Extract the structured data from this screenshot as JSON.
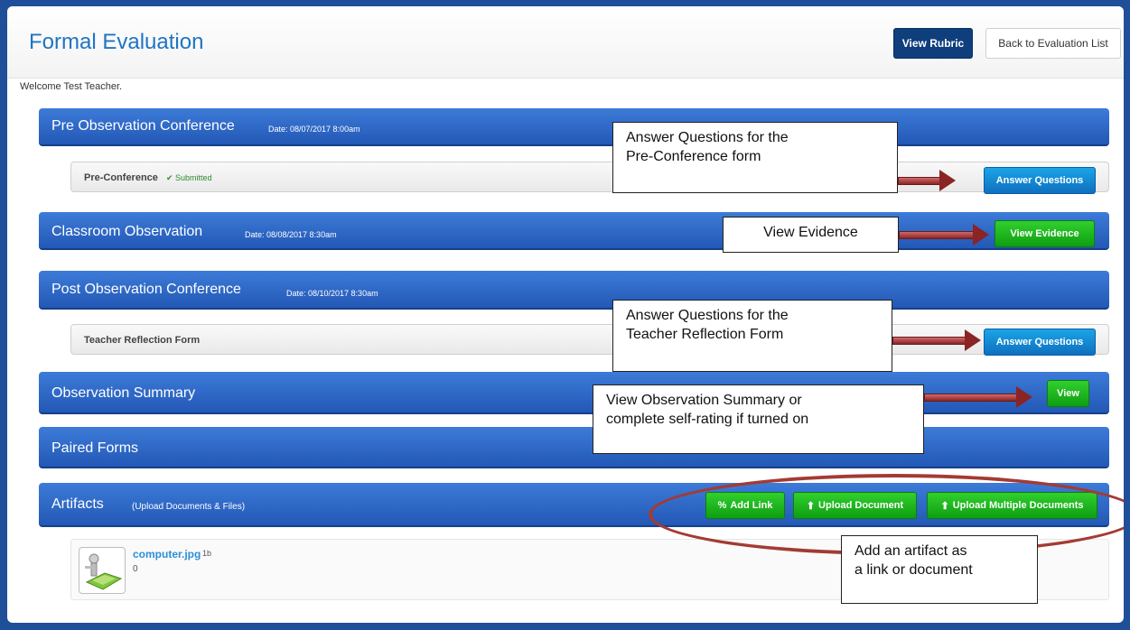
{
  "header": {
    "title": "Formal Evaluation",
    "view_rubric_label": "View Rubric",
    "back_label": "Back to Evaluation List"
  },
  "welcome_text": "Welcome Test Teacher.",
  "sections": {
    "pre_observation": {
      "title": "Pre Observation Conference",
      "date": "Date: 08/07/2017 8:00am",
      "form_label": "Pre-Conference",
      "status": "Submitted",
      "button": "Answer Questions"
    },
    "classroom_observation": {
      "title": "Classroom Observation",
      "date": "Date: 08/08/2017 8:30am",
      "button": "View Evidence"
    },
    "post_observation": {
      "title": "Post Observation Conference",
      "date": "Date: 08/10/2017 8:30am",
      "form_label": "Teacher Reflection Form",
      "button": "Answer Questions"
    },
    "observation_summary": {
      "title": "Observation Summary",
      "button": "View"
    },
    "paired_forms": {
      "title": "Paired Forms"
    },
    "artifacts": {
      "title": "Artifacts",
      "subtitle": "(Upload Documents & Files)",
      "add_link": "Add Link",
      "upload_document": "Upload Document",
      "upload_multiple": "Upload Multiple Documents",
      "file_name": "computer.jpg",
      "file_size": "1b",
      "file_count": "0"
    }
  },
  "callouts": {
    "pre_conf_line1": "Answer Questions for the",
    "pre_conf_line2": "Pre-Conference form",
    "view_evidence": "View Evidence",
    "reflection_line1": "Answer Questions for the",
    "reflection_line2": "Teacher Reflection Form",
    "summary_line1": "View Observation Summary or",
    "summary_line2": "complete self-rating if turned on",
    "artifact_line1": "Add an artifact as",
    "artifact_line2": "a link or document"
  },
  "colors": {
    "section_blue": "#2d6ac7",
    "accent_green": "#18ac18",
    "callout_arrow": "#8b2424"
  }
}
